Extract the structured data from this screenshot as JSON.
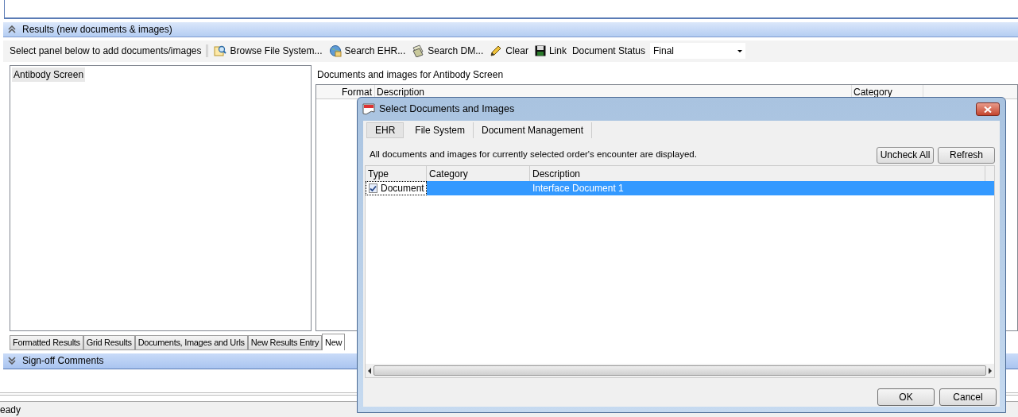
{
  "results_section": {
    "title": "Results (new documents & images)",
    "expanded": true
  },
  "toolbar": {
    "hint": "Select panel below to add documents/images",
    "items": [
      {
        "kind": "browse",
        "label": "Browse File System..."
      },
      {
        "kind": "ehr",
        "label": "Search EHR..."
      },
      {
        "kind": "dm",
        "label": "Search DM..."
      },
      {
        "kind": "clear",
        "label": "Clear"
      },
      {
        "kind": "link",
        "label": "Link"
      }
    ],
    "status_label": "Document Status",
    "status_value": "Final"
  },
  "orders": [
    {
      "label": "Antibody Screen",
      "selected": true
    }
  ],
  "documents_panel": {
    "caption": "Documents and images for Antibody Screen",
    "columns": [
      "Format",
      "Description",
      "Category"
    ]
  },
  "bottom_tabs": [
    {
      "label": "Formatted Results",
      "selected": false
    },
    {
      "label": "Grid Results",
      "selected": false
    },
    {
      "label": "Documents, Images and Urls",
      "selected": false
    },
    {
      "label": "New Results Entry",
      "selected": false
    },
    {
      "label": "New",
      "selected": true
    }
  ],
  "signoff_section": {
    "title": "Sign-off Comments",
    "expanded": false
  },
  "status_bar": "eady",
  "dialog": {
    "title": "Select Documents and Images",
    "tabs": [
      {
        "label": "EHR",
        "selected": true
      },
      {
        "label": "File System",
        "selected": false
      },
      {
        "label": "Document Management",
        "selected": false
      }
    ],
    "info": "All documents and images for currently selected order's encounter are displayed.",
    "actions": [
      "Uncheck All",
      "Refresh"
    ],
    "columns": [
      "Type",
      "Category",
      "Description"
    ],
    "rows": [
      {
        "type": "Document",
        "checked": true,
        "description": "Interface Document 1",
        "selected": true
      }
    ],
    "buttons": [
      "OK",
      "Cancel"
    ]
  }
}
